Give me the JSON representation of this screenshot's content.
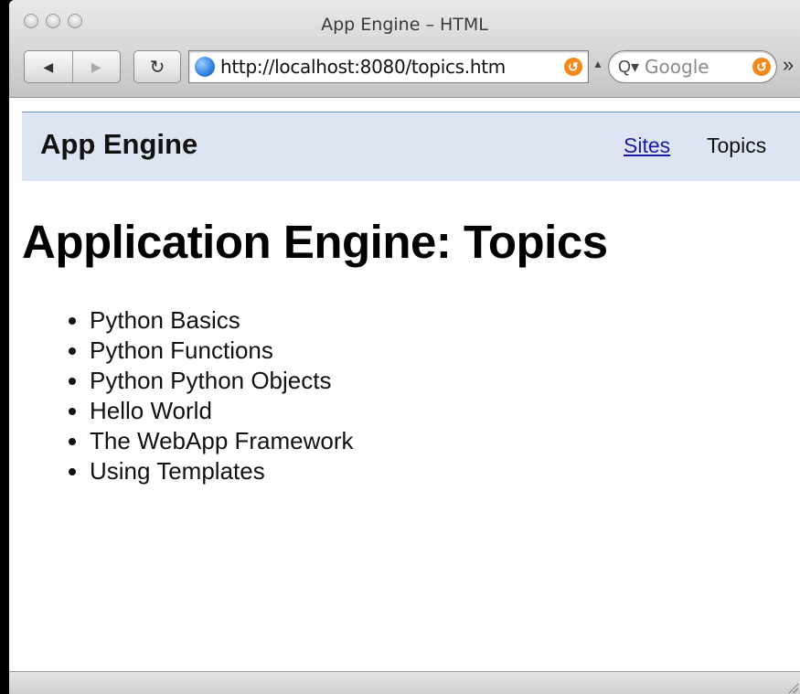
{
  "window": {
    "title": "App Engine – HTML"
  },
  "toolbar": {
    "back_icon": "◀",
    "forward_icon": "▶",
    "reload_icon": "↻",
    "url": "http://localhost:8080/topics.htm",
    "search_placeholder": "Google",
    "search_icon": "Q▾",
    "snapback_icon": "↺",
    "overflow_icon": "»"
  },
  "page": {
    "brand": "App Engine",
    "nav": [
      {
        "label": "Sites",
        "link": true
      },
      {
        "label": "Topics",
        "link": false
      }
    ],
    "heading": "Application Engine: Topics",
    "topics": [
      "Python Basics",
      "Python Functions",
      "Python Python Objects",
      "Hello World",
      "The WebApp Framework",
      "Using Templates"
    ]
  },
  "colors": {
    "header_bg": "#dde5f3",
    "header_border": "#6b8fc7",
    "link": "#1a1aa6",
    "snapback": "#f08a1c"
  }
}
